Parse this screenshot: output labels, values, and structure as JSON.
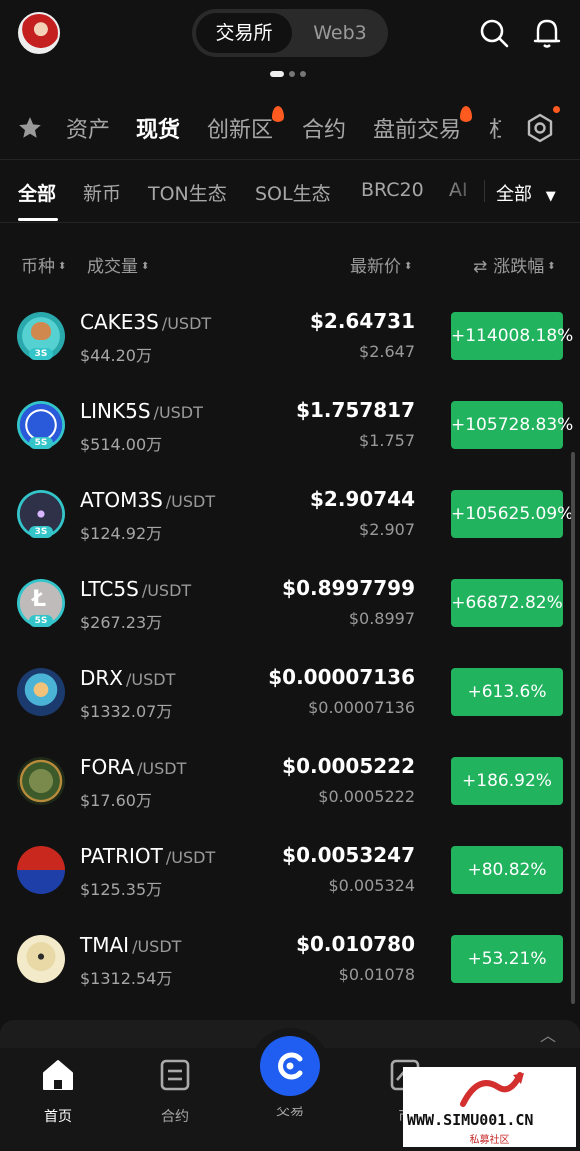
{
  "header": {
    "segments": [
      "交易所",
      "Web3"
    ]
  },
  "categories": [
    {
      "label": "资产"
    },
    {
      "label": "现货"
    },
    {
      "label": "创新区"
    },
    {
      "label": "合约"
    },
    {
      "label": "盘前交易"
    },
    {
      "label": "杠"
    }
  ],
  "subtabs": [
    "全部",
    "新币",
    "TON生态",
    "SOL生态",
    "BRC20",
    "AI"
  ],
  "subtab_filter": "全部",
  "columns": {
    "coin": "币种",
    "volume": "成交量",
    "last_price": "最新价",
    "change": "涨跌幅"
  },
  "rows": [
    {
      "symbol": "CAKE3S",
      "pair": "/USDT",
      "volume": "$44.20万",
      "price": "$2.64731",
      "sub_price": "$2.647",
      "change": "+114008.18%",
      "icon": "cake3s-icon",
      "badge": "3S"
    },
    {
      "symbol": "LINK5S",
      "pair": "/USDT",
      "volume": "$514.00万",
      "price": "$1.757817",
      "sub_price": "$1.757",
      "change": "+105728.83%",
      "icon": "link5s-icon",
      "badge": "5S"
    },
    {
      "symbol": "ATOM3S",
      "pair": "/USDT",
      "volume": "$124.92万",
      "price": "$2.90744",
      "sub_price": "$2.907",
      "change": "+105625.09%",
      "icon": "atom3s-icon",
      "badge": "3S"
    },
    {
      "symbol": "LTC5S",
      "pair": "/USDT",
      "volume": "$267.23万",
      "price": "$0.8997799",
      "sub_price": "$0.8997",
      "change": "+66872.82%",
      "icon": "ltc5s-icon",
      "badge": "5S"
    },
    {
      "symbol": "DRX",
      "pair": "/USDT",
      "volume": "$1332.07万",
      "price": "$0.00007136",
      "sub_price": "$0.00007136",
      "change": "+613.6%",
      "icon": "drx-icon",
      "badge": ""
    },
    {
      "symbol": "FORA",
      "pair": "/USDT",
      "volume": "$17.60万",
      "price": "$0.0005222",
      "sub_price": "$0.0005222",
      "change": "+186.92%",
      "icon": "fora-icon",
      "badge": ""
    },
    {
      "symbol": "PATRIOT",
      "pair": "/USDT",
      "volume": "$125.35万",
      "price": "$0.0053247",
      "sub_price": "$0.005324",
      "change": "+80.82%",
      "icon": "patriot-icon",
      "badge": ""
    },
    {
      "symbol": "TMAI",
      "pair": "/USDT",
      "volume": "$1312.54万",
      "price": "$0.010780",
      "sub_price": "$0.01078",
      "change": "+53.21%",
      "icon": "tmai-icon",
      "badge": ""
    }
  ],
  "bottom_nav": [
    {
      "label": "首页",
      "icon": "home-icon"
    },
    {
      "label": "合约",
      "icon": "contract-icon"
    },
    {
      "label": "交易",
      "icon": "trade-icon"
    },
    {
      "label": "币",
      "icon": "chart-icon"
    }
  ],
  "watermark": {
    "text": "WWW.SIMU001.CN",
    "subtext": "私募社区"
  },
  "colors": {
    "background": "#121212",
    "positive": "#22b35e",
    "accent": "#1f5ef0",
    "hot": "#ff5a1f"
  }
}
